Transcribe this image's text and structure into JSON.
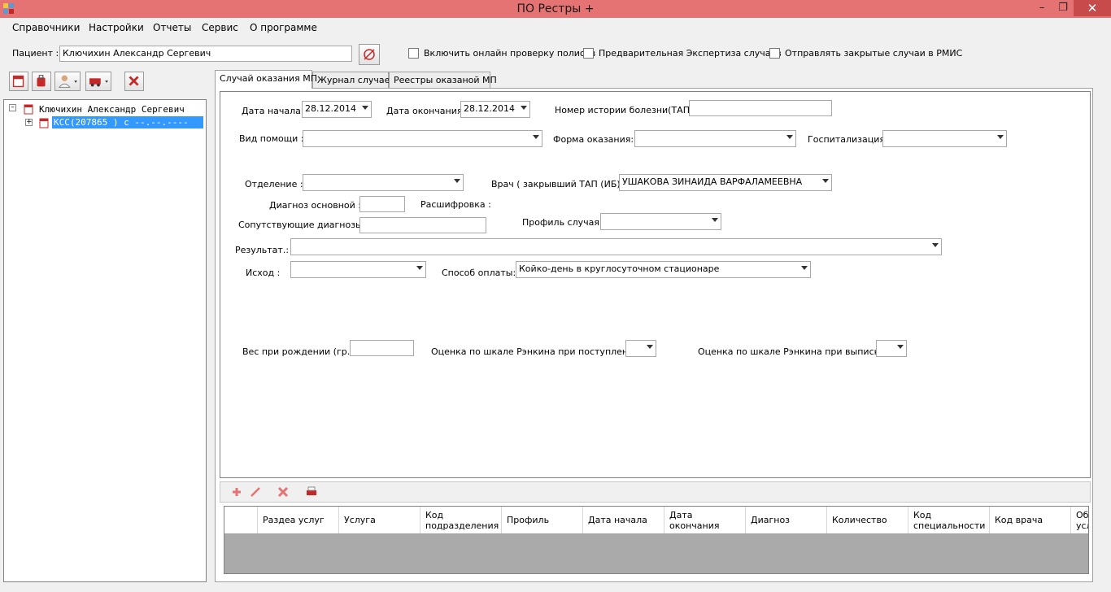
{
  "window": {
    "title": "ПО Рестры +",
    "minimize_glyph": "–",
    "maximize_glyph": "❐",
    "close_glyph": "✕"
  },
  "menu": [
    "Справочники",
    "Настройки",
    "Отчеты",
    "Сервис",
    "О программе"
  ],
  "patient": {
    "label": "Пациент :",
    "value": "Ключихин Александр Сергевич"
  },
  "options": {
    "online_check": "Включить онлайн проверку полисов",
    "pre_expertise": "Предварительная Экспертиза случаев",
    "send_rmis": "Отправлять закрытые случаи в РМИС"
  },
  "tree": {
    "root_label": "Ключихин Александр Сергевич",
    "child_label": "КСС(207865   ) с --.--.----"
  },
  "tabs": [
    "Случай оказания МП",
    "Журнал случаев",
    "Реестры оказаной МП"
  ],
  "form": {
    "start_date_label": "Дата начала:",
    "start_date": "28.12.2014",
    "end_date_label": "Дата окончания:",
    "end_date": "28.12.2014",
    "history_label": "Номер истории болезни(ТАП) :",
    "history_value": "",
    "help_type_label": "Вид помощи :",
    "help_type_value": "",
    "form_label": "Форма оказания:",
    "form_value": "",
    "hosp_label": "Госпитализация :",
    "hosp_value": "",
    "dept_label": "Отделение :",
    "dept_value": "",
    "doctor_label": "Врач ( закрывший ТАП (ИБ)) :",
    "doctor_value": "УШАКОВА ЗИНАИДА ВАРФАЛАМЕЕВНА",
    "diag_main_label": "Диагноз основной :",
    "diag_main_value": "",
    "decode_label": "Расшифровка :",
    "co_diag_label": "Сопутствующие диагнозы :",
    "co_diag_value": "",
    "profile_label": "Профиль случая:",
    "profile_value": "",
    "result_label": "Результат.:",
    "result_value": "",
    "outcome_label": "Исход  :",
    "outcome_value": "",
    "payment_label": "Способ оплаты:",
    "payment_value": "Койко-день в круглосуточном стационаре",
    "birth_weight_label": "Вес при рождении (гр.)",
    "birth_weight_value": "",
    "rankin_in_label": "Оценка по шкале Рэнкина при поступлении :",
    "rankin_in_value": "",
    "rankin_out_label": "Оценка по шкале Рэнкина при выписке :",
    "rankin_out_value": ""
  },
  "grid": {
    "columns": [
      "Раздеа услуг",
      "Услуга",
      "Код подразделения",
      "Профиль",
      "Дата начала",
      "Дата окончания",
      "Диагноз",
      "Количество",
      "Код специальности",
      "Код врача",
      "Об усл"
    ]
  },
  "icons": {
    "app": "app-icon",
    "patient_search": "pen-icon",
    "toolbar": [
      "calendar-icon",
      "bag-icon",
      "doctor-icon",
      "ambulance-icon",
      "delete-icon"
    ],
    "grid_toolbar": [
      "add-icon",
      "edit-icon",
      "delete-icon",
      "print-icon"
    ],
    "accent_red": "#c62828",
    "titlebar_color": "#e57373"
  }
}
